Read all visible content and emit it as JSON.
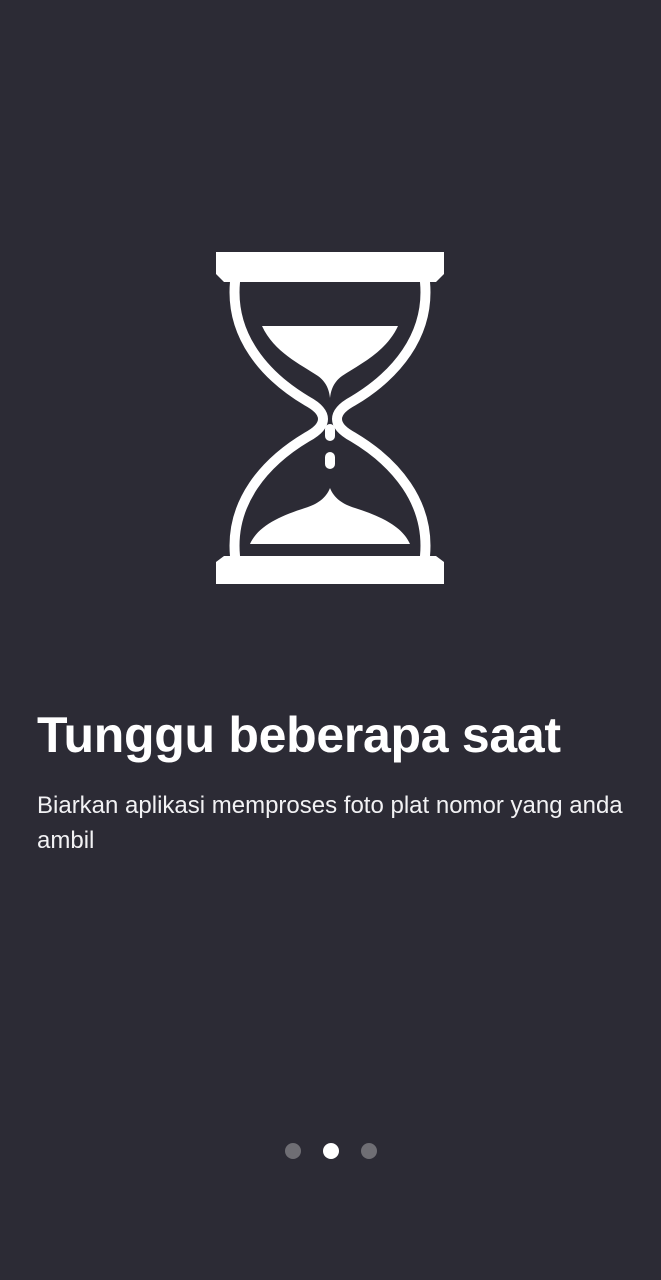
{
  "onboarding": {
    "icon": "hourglass-icon",
    "title": "Tunggu beberapa saat",
    "description": "Biarkan aplikasi memproses foto plat nomor yang anda ambil",
    "pager": {
      "total_pages": 3,
      "current_page": 2
    }
  },
  "colors": {
    "background": "#2c2b35",
    "text": "#ffffff",
    "dot_inactive": "#6f6e74",
    "dot_active": "#ffffff"
  }
}
